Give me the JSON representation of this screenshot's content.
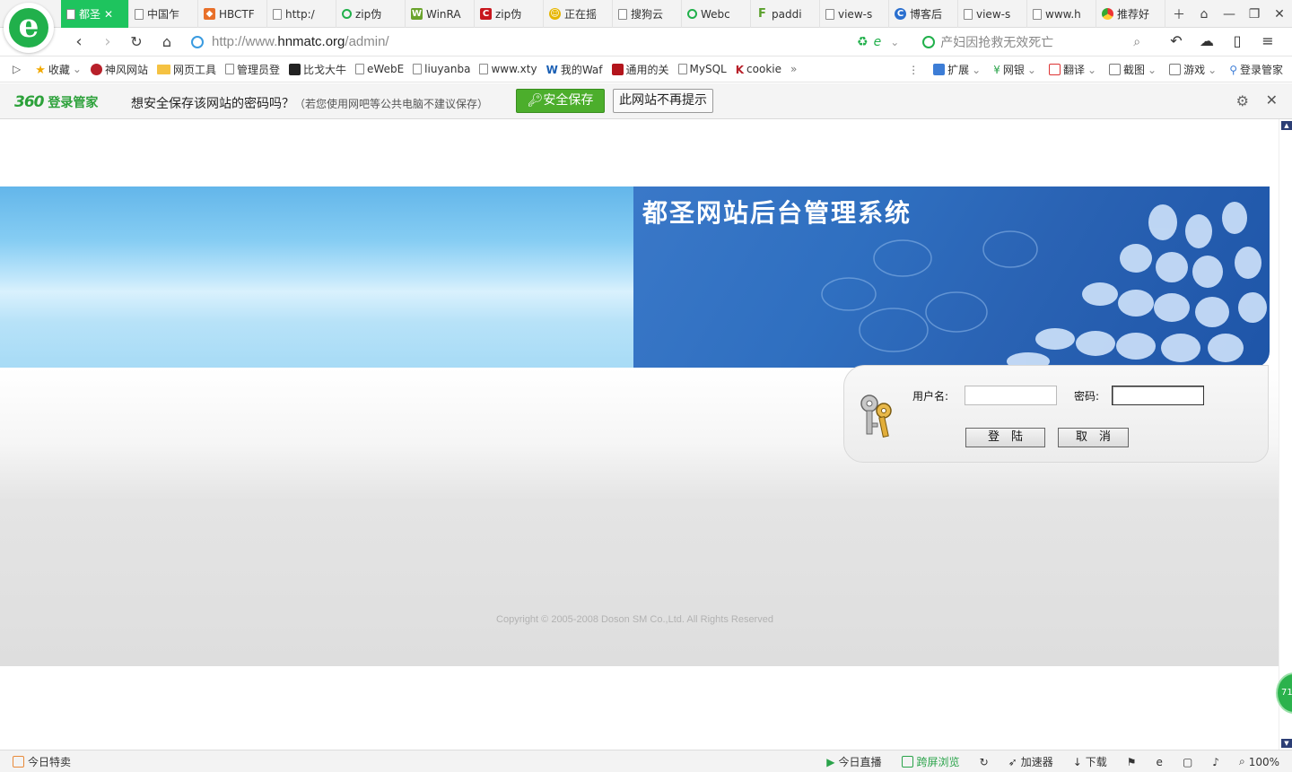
{
  "browser": {
    "tabs": [
      {
        "label": "都圣",
        "icon": "doc",
        "active": true
      },
      {
        "label": "中国乍",
        "icon": "doc"
      },
      {
        "label": "HBCTF",
        "icon": "shield"
      },
      {
        "label": "http:/",
        "icon": "doc"
      },
      {
        "label": "zip伪",
        "icon": "search-o"
      },
      {
        "label": "WinRA",
        "icon": "winrar"
      },
      {
        "label": "zip伪",
        "icon": "csdn"
      },
      {
        "label": "正在摇",
        "icon": "smile"
      },
      {
        "label": "搜狗云",
        "icon": "doc"
      },
      {
        "label": "Webc",
        "icon": "search-o"
      },
      {
        "label": "paddi",
        "icon": "f"
      },
      {
        "label": "view-s",
        "icon": "doc"
      },
      {
        "label": "博客后",
        "icon": "cnblogs"
      },
      {
        "label": "view-s",
        "icon": "doc"
      },
      {
        "label": "www.h",
        "icon": "doc"
      },
      {
        "label": "推荐好",
        "icon": "chrome"
      }
    ],
    "url_prefix": "http://www.",
    "url_domain": "hnmatc.org",
    "url_path": "/admin/",
    "search_hint": "产妇因抢救无效死亡",
    "bookmarks": [
      {
        "label": "收藏",
        "icon": "star"
      },
      {
        "label": "神风网站",
        "icon": "red"
      },
      {
        "label": "网页工具",
        "icon": "folder"
      },
      {
        "label": "管理员登",
        "icon": "doc"
      },
      {
        "label": "比戈大牛",
        "icon": "black"
      },
      {
        "label": "eWebE",
        "icon": "doc"
      },
      {
        "label": "liuyanba",
        "icon": "doc"
      },
      {
        "label": "www.xty",
        "icon": "doc"
      },
      {
        "label": "我的Waf",
        "icon": "w"
      },
      {
        "label": "通用的关",
        "icon": "redshield"
      },
      {
        "label": "MySQL",
        "icon": "doc"
      },
      {
        "label": "cookie",
        "icon": "k"
      }
    ],
    "bookmark_more": "»",
    "bm_right": [
      {
        "label": "扩展"
      },
      {
        "label": "网银"
      },
      {
        "label": "翻译"
      },
      {
        "label": "截图"
      },
      {
        "label": "游戏"
      },
      {
        "label": "登录管家"
      }
    ]
  },
  "pwbar": {
    "brand_num": "360",
    "brand_text": "登录管家",
    "message": "想安全保存该网站的密码吗？",
    "note": "（若您使用网吧等公共电脑不建议保存）",
    "save_label": "安全保存",
    "never_label": "此网站不再提示"
  },
  "page": {
    "title": "都圣网站后台管理系统",
    "username_label": "用户名:",
    "password_label": "密码:",
    "username_value": "",
    "password_value": "",
    "login_label": "登　陆",
    "cancel_label": "取　消",
    "copyright": "Copyright © 2005-2008 Doson SM Co.,Ltd. All Rights Reserved",
    "float_badge": "71"
  },
  "status": {
    "left": "今日特卖",
    "items": [
      "今日直播",
      "跨屏浏览",
      "加速器",
      "下载"
    ],
    "zoom": "100%"
  },
  "colors": {
    "accent_green": "#1ec45e",
    "banner_blue": "#2f6fc0",
    "save_green": "#4cae2c"
  }
}
